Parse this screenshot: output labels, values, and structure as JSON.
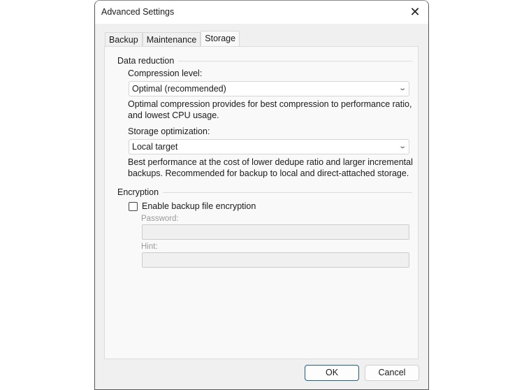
{
  "window": {
    "title": "Advanced Settings",
    "close_icon": "close-icon"
  },
  "tabs": [
    {
      "label": "Backup"
    },
    {
      "label": "Maintenance"
    },
    {
      "label": "Storage",
      "active": true
    }
  ],
  "data_reduction": {
    "group_label": "Data reduction",
    "compression_label": "Compression level:",
    "compression_value": "Optimal (recommended)",
    "compression_desc": "Optimal compression provides for best compression to performance ratio, and lowest CPU usage.",
    "optimization_label": "Storage optimization:",
    "optimization_value": "Local target",
    "optimization_desc": "Best performance at the cost of lower dedupe ratio and larger incremental backups. Recommended for backup to local and direct-attached storage."
  },
  "encryption": {
    "group_label": "Encryption",
    "checkbox_label": "Enable backup file encryption",
    "checked": false,
    "password_label": "Password:",
    "password_value": "",
    "hint_label": "Hint:",
    "hint_value": ""
  },
  "buttons": {
    "ok": "OK",
    "cancel": "Cancel"
  }
}
